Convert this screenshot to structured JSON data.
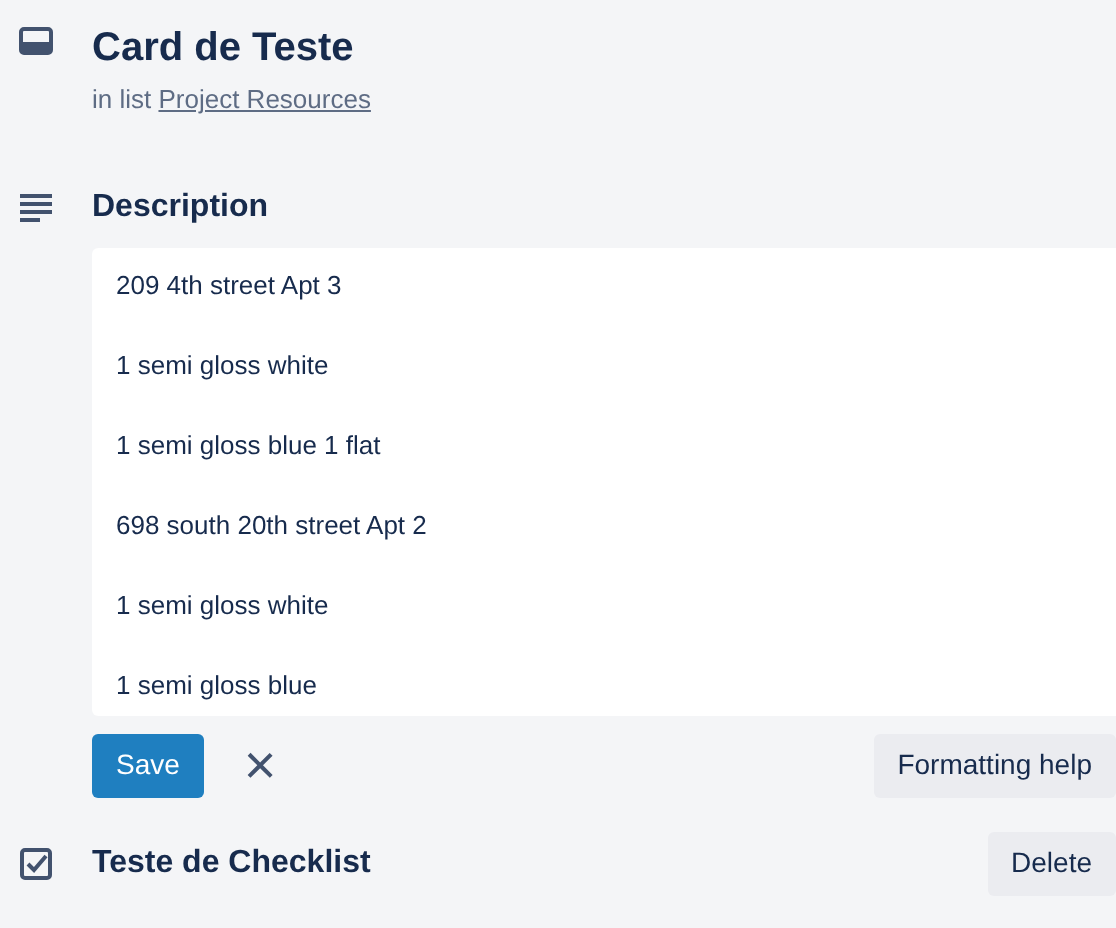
{
  "card": {
    "title": "Card de Teste",
    "list_prefix": "in list",
    "list_name": "Project Resources"
  },
  "description": {
    "heading": "Description",
    "lines": [
      "209 4th street Apt 3",
      "1 semi gloss white",
      "1 semi gloss blue 1 flat",
      "698 south 20th street Apt 2",
      "1 semi gloss white",
      "1 semi gloss blue"
    ],
    "save": "Save",
    "close": "×",
    "help": "Formatting help"
  },
  "checklist": {
    "title": "Teste de Checklist",
    "delete": "Delete"
  }
}
